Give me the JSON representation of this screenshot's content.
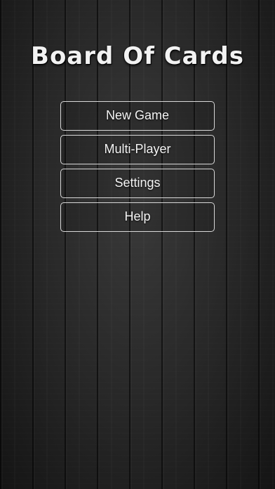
{
  "app": {
    "title": "Board Of Cards"
  },
  "menu": {
    "items": [
      {
        "label": "New Game"
      },
      {
        "label": "Multi-Player"
      },
      {
        "label": "Settings"
      },
      {
        "label": "Help"
      }
    ]
  },
  "colors": {
    "background": "#262626",
    "button_border": "#d8d8d8",
    "text": "#f4f4f4"
  }
}
